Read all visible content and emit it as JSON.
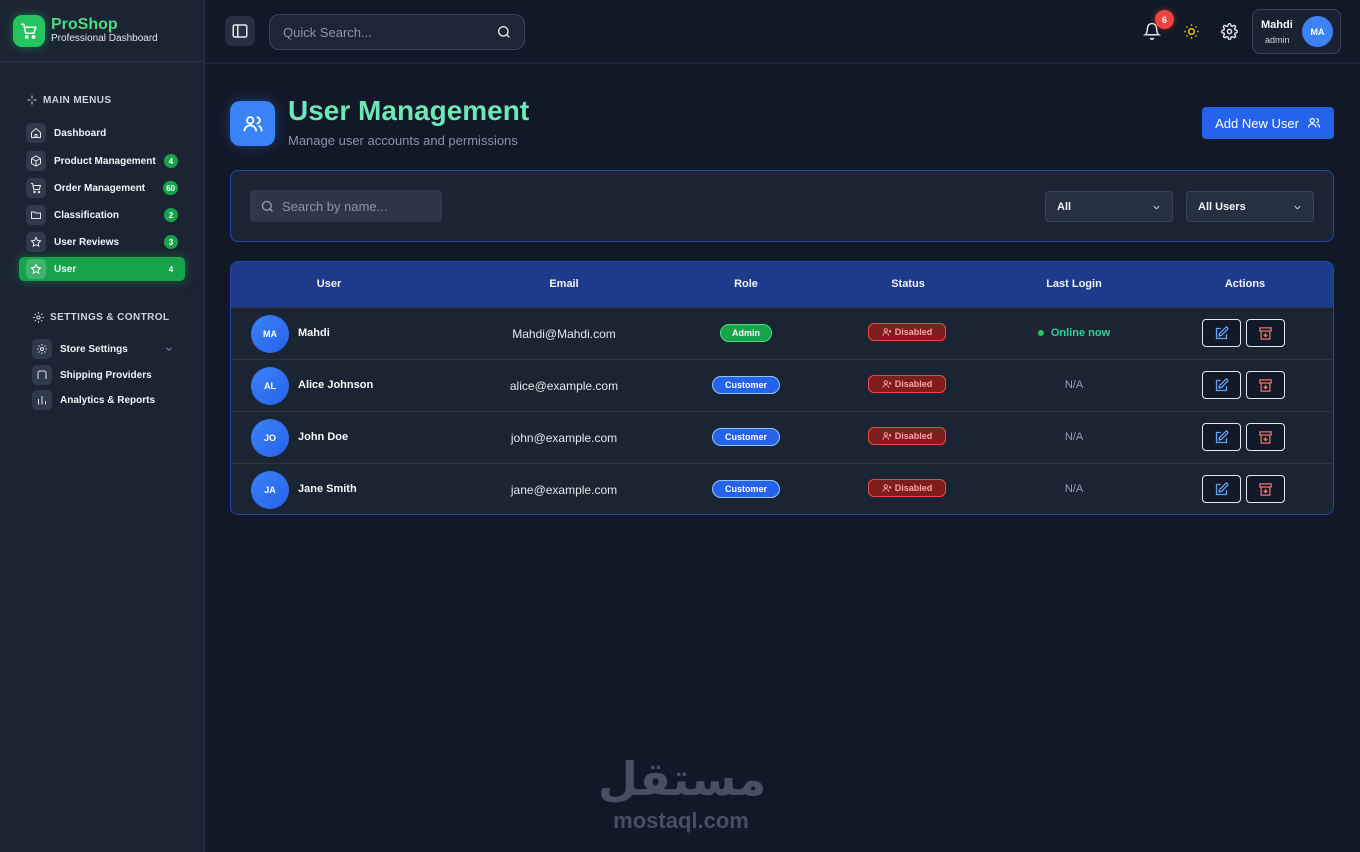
{
  "brand": {
    "name": "ProShop",
    "subtitle": "Professional Dashboard"
  },
  "sidebar": {
    "main_title": "MAIN MENUS",
    "items": [
      {
        "label": "Dashboard",
        "icon": "home-icon",
        "badge": ""
      },
      {
        "label": "Product Management",
        "icon": "box-icon",
        "badge": "4"
      },
      {
        "label": "Order Management",
        "icon": "cart-icon",
        "badge": "60"
      },
      {
        "label": "Classification",
        "icon": "folder-icon",
        "badge": "2"
      },
      {
        "label": "User Reviews",
        "icon": "star-icon",
        "badge": "3"
      },
      {
        "label": "User",
        "icon": "star-icon",
        "badge": "4",
        "active": true
      }
    ],
    "settings_title": "SETTINGS & CONTROL",
    "settings_items": [
      {
        "label": "Store Settings",
        "icon": "gear-icon"
      },
      {
        "label": "Shipping Providers",
        "icon": "truck-icon"
      },
      {
        "label": "Analytics & Reports",
        "icon": "bar-chart-icon"
      }
    ]
  },
  "topbar": {
    "search_placeholder": "Quick Search...",
    "notifications": "6",
    "user_name": "Mahdi",
    "user_role": "admin",
    "user_initials": "MA"
  },
  "page": {
    "title": "User Management",
    "subtitle": "Manage user accounts and permissions",
    "add_button": "Add New User"
  },
  "filters": {
    "search_placeholder": "Search by name...",
    "role_select": "All",
    "user_select": "All Users"
  },
  "table": {
    "columns": [
      "User",
      "Email",
      "Role",
      "Status",
      "Last Login",
      "Actions"
    ],
    "rows": [
      {
        "initials": "MA",
        "name": "Mahdi",
        "email": "Mahdi@Mahdi.com",
        "role": "Admin",
        "status": "Disabled",
        "last_login": "Online now"
      },
      {
        "initials": "AL",
        "name": "Alice Johnson",
        "email": "alice@example.com",
        "role": "Customer",
        "status": "Disabled",
        "last_login": "N/A"
      },
      {
        "initials": "JO",
        "name": "John Doe",
        "email": "john@example.com",
        "role": "Customer",
        "status": "Disabled",
        "last_login": "N/A"
      },
      {
        "initials": "JA",
        "name": "Jane Smith",
        "email": "jane@example.com",
        "role": "Customer",
        "status": "Disabled",
        "last_login": "N/A"
      }
    ]
  },
  "watermark": {
    "arabic": "مستقل",
    "latin": "mostaql.com"
  },
  "colors": {
    "accent_green": "#22c55e",
    "accent_blue": "#2563eb",
    "danger": "#ef4444",
    "background": "#111827"
  }
}
